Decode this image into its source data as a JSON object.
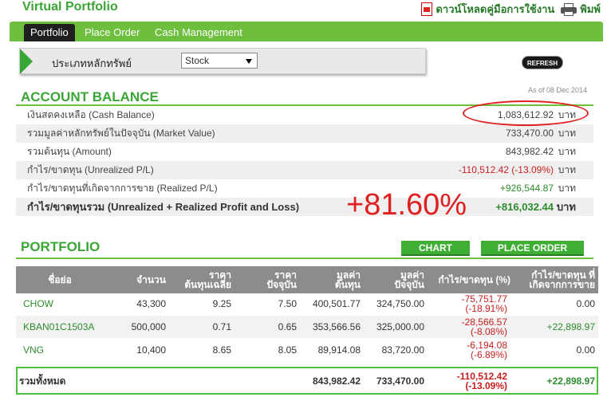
{
  "header": {
    "title": "Virtual Portfolio",
    "download_label": "ดาวน์โหลดคู่มือการใช้งาน",
    "print_label": "พิมพ์"
  },
  "tabs": [
    {
      "label": "Portfolio",
      "active": true
    },
    {
      "label": "Place Order",
      "active": false
    },
    {
      "label": "Cash Management",
      "active": false
    }
  ],
  "filter": {
    "label": "ประเภทหลักทรัพย์",
    "selected": "Stock"
  },
  "refresh_label": "REFRESH",
  "account": {
    "title": "ACCOUNT BALANCE",
    "as_of": "As of 08 Dec 2014",
    "unit": "บาท",
    "rows": [
      {
        "label": "เงินสดคงเหลือ (Cash Balance)",
        "value": "1,083,612.92"
      },
      {
        "label": "รวมมูลค่าหลักทรัพย์ในปัจจุบัน (Market Value)",
        "value": "733,470.00"
      },
      {
        "label": "รวมต้นทุน (Amount)",
        "value": "843,982.42"
      },
      {
        "label": "กำไร/ขาดทุน (Unrealized P/L)",
        "value": "-110,512.42 (-13.09%)"
      },
      {
        "label": "กำไร/ขาดทุนที่เกิดจากการขาย (Realized P/L)",
        "value": "+926,544.87"
      },
      {
        "label": "กำไร/ขาดทุนรวม (Unrealized + Realized Profit and Loss)",
        "value": "+816,032.44"
      }
    ]
  },
  "annotation": {
    "big_percent": "+81.60%"
  },
  "portfolio": {
    "title": "PORTFOLIO",
    "chart_button": "CHART",
    "place_order_button": "PLACE ORDER",
    "columns": [
      "ชื่อย่อ",
      "จำนวน",
      "ราคา\nต้นทุนเฉลี่ย",
      "ราคา\nปัจจุบัน",
      "มูลค่า\nต้นทุน",
      "มูลค่า\nปัจจุบัน",
      "กำไร/ขาดทุน (%)",
      "กำไร/ขาดทุน ที่\nเกิดจากการขาย"
    ],
    "rows": [
      {
        "symbol": "CHOW",
        "qty": "43,300",
        "avg_cost": "9.25",
        "price": "7.50",
        "cost_value": "400,501.77",
        "market_value": "324,750.00",
        "pl": "-75,751.77",
        "pl_pct": "(-18.91%)",
        "realized": "0.00"
      },
      {
        "symbol": "KBAN01C1503A",
        "qty": "500,000",
        "avg_cost": "0.71",
        "price": "0.65",
        "cost_value": "353,566.56",
        "market_value": "325,000.00",
        "pl": "-28,566.57",
        "pl_pct": "(-8.08%)",
        "realized": "+22,898.97"
      },
      {
        "symbol": "VNG",
        "qty": "10,400",
        "avg_cost": "8.65",
        "price": "8.05",
        "cost_value": "89,914.08",
        "market_value": "83,720.00",
        "pl": "-6,194.08",
        "pl_pct": "(-6.89%)",
        "realized": "0.00"
      }
    ],
    "total": {
      "label": "รวมทั้งหมด",
      "cost_value": "843,982.42",
      "market_value": "733,470.00",
      "pl": "-110,512.42",
      "pl_pct": "(-13.09%)",
      "realized": "+22,898.97"
    }
  },
  "colors": {
    "brand_green": "#3aa635",
    "tab_green": "#6fbf3f",
    "negative": "#c81e1e",
    "positive": "#2d8c2d",
    "annotation_red": "#e02020"
  }
}
